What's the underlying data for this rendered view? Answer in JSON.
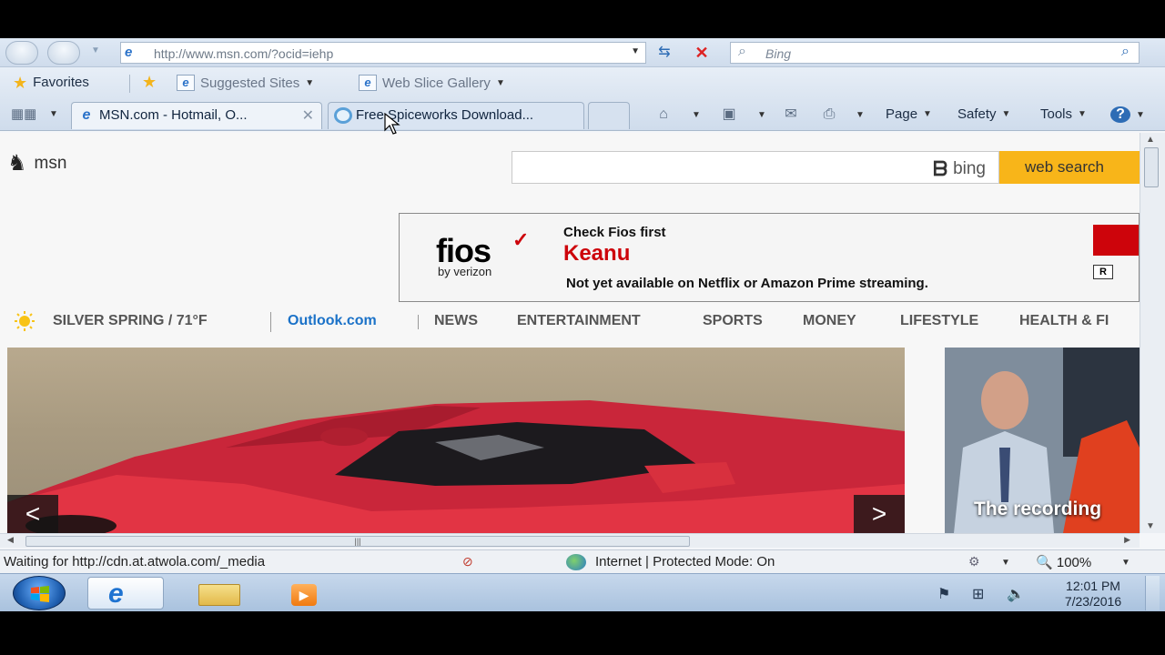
{
  "browser": {
    "address": {
      "url": "http://www.msn.com/?ocid=iehp"
    },
    "search": {
      "placeholder": "Bing"
    },
    "favorites_bar": {
      "favorites_label": "Favorites",
      "suggested_sites_label": "Suggested Sites",
      "web_slice_gallery_label": "Web Slice Gallery"
    },
    "tabs": [
      {
        "title": "MSN.com - Hotmail, O...",
        "active": true
      },
      {
        "title": "Free Spiceworks Download...",
        "active": false
      }
    ],
    "command_bar": {
      "page_label": "Page",
      "safety_label": "Safety",
      "tools_label": "Tools"
    },
    "status_bar": {
      "status_text": "Waiting for http://cdn.at.atwola.com/_media",
      "zone_text": "Internet | Protected Mode: On",
      "zoom_text": "100%"
    }
  },
  "page": {
    "logo_text": "msn",
    "search": {
      "bing_label": "bing",
      "button_label": "web search"
    },
    "ad": {
      "brand": "fios",
      "brand_sub": "by verizon",
      "headline": "Check Fios first",
      "title": "Keanu",
      "note": "Not yet available on Netflix or Amazon Prime streaming.",
      "rating": "R"
    },
    "nav": {
      "weather": "SILVER SPRING / 71°F",
      "outlook": "Outlook.com",
      "items": [
        "NEWS",
        "ENTERTAINMENT",
        "SPORTS",
        "MONEY",
        "LIFESTYLE",
        "HEALTH & FI"
      ]
    },
    "hero": {
      "prev_label": "<",
      "next_label": ">"
    },
    "side_card": {
      "caption": "The recording"
    }
  },
  "taskbar": {
    "time": "12:01 PM",
    "date": "7/23/2016"
  },
  "colors": {
    "msn_search_button": "#f8b519",
    "outlook_link": "#1b72c8",
    "fios_red": "#cd040b"
  }
}
